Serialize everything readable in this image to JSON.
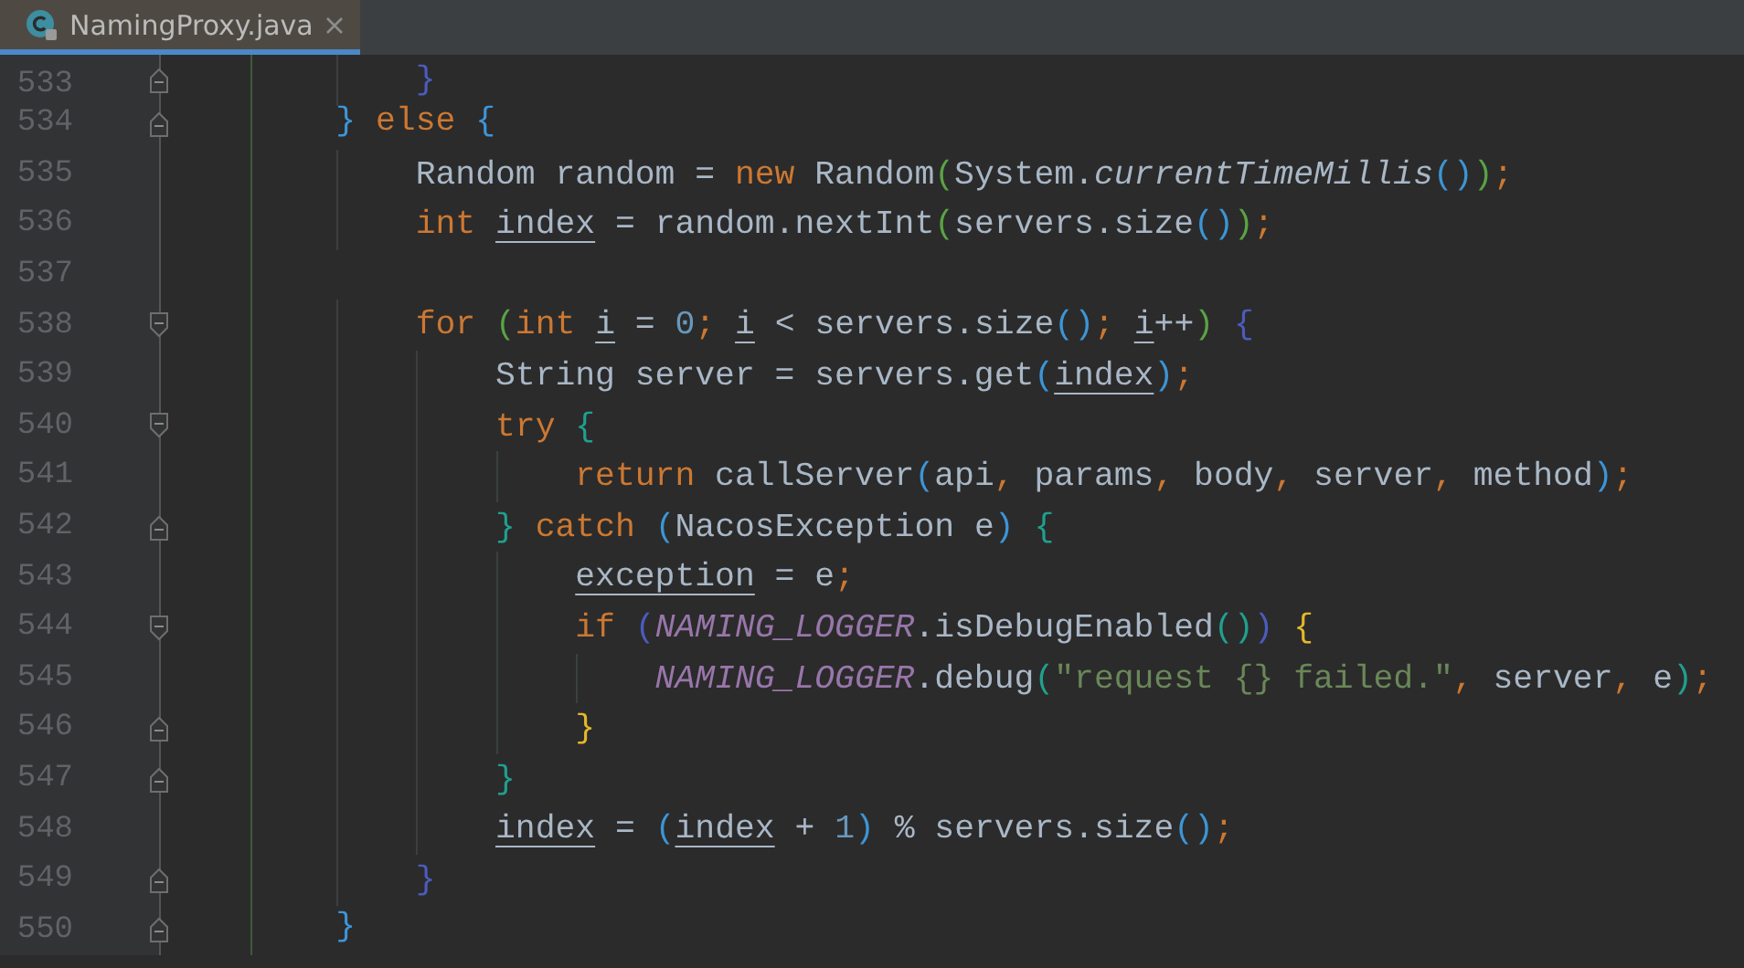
{
  "tab": {
    "title": "NamingProxy.java",
    "selected": true
  },
  "lines": [
    {
      "number": "533",
      "fold_start": false,
      "fold_end": true,
      "tokens": [
        {
          "text": "        }",
          "kind": "bracket",
          "color": "#4c5bbf"
        }
      ]
    },
    {
      "number": "534",
      "fold_start": false,
      "fold_end": true,
      "tokens": [
        {
          "text": "    }",
          "kind": "bracket",
          "color": "#3d95d6"
        },
        {
          "text": " else",
          "kind": "keyword"
        },
        {
          "text": " {",
          "kind": "bracket",
          "color": "#3d95d6"
        }
      ]
    },
    {
      "number": "535",
      "fold_start": false,
      "fold_end": false,
      "tokens": [
        {
          "text": "        Random random = ",
          "kind": "plain"
        },
        {
          "text": "new",
          "kind": "keyword"
        },
        {
          "text": " Random",
          "kind": "plain"
        },
        {
          "text": "(",
          "kind": "bracket",
          "color": "#5aa344"
        },
        {
          "text": "System.",
          "kind": "plain"
        },
        {
          "text": "currentTimeMillis",
          "kind": "italic"
        },
        {
          "text": "()",
          "kind": "bracket",
          "color": "#3d95d6"
        },
        {
          "text": ")",
          "kind": "bracket",
          "color": "#5aa344"
        },
        {
          "text": ";",
          "kind": "punct"
        }
      ]
    },
    {
      "number": "536",
      "fold_start": false,
      "fold_end": false,
      "tokens": [
        {
          "text": "        int ",
          "kind": "keyword"
        },
        {
          "text": "index",
          "kind": "reassigned"
        },
        {
          "text": " = random.nextInt",
          "kind": "plain"
        },
        {
          "text": "(",
          "kind": "bracket",
          "color": "#5aa344"
        },
        {
          "text": "servers.size",
          "kind": "plain"
        },
        {
          "text": "()",
          "kind": "bracket",
          "color": "#3d95d6"
        },
        {
          "text": ")",
          "kind": "bracket",
          "color": "#5aa344"
        },
        {
          "text": ";",
          "kind": "punct"
        }
      ]
    },
    {
      "number": "537",
      "fold_start": false,
      "fold_end": false
    },
    {
      "number": "538",
      "fold_start": true,
      "fold_end": false,
      "tokens": [
        {
          "text": "        for",
          "kind": "keyword"
        },
        {
          "text": " (",
          "kind": "bracket",
          "color": "#5aa344"
        },
        {
          "text": "int ",
          "kind": "keyword"
        },
        {
          "text": "i",
          "kind": "reassigned"
        },
        {
          "text": " = ",
          "kind": "plain"
        },
        {
          "text": "0",
          "kind": "number"
        },
        {
          "text": "; ",
          "kind": "punct"
        },
        {
          "text": "i",
          "kind": "reassigned"
        },
        {
          "text": " < servers.size",
          "kind": "plain"
        },
        {
          "text": "()",
          "kind": "bracket",
          "color": "#3d95d6"
        },
        {
          "text": "; ",
          "kind": "punct"
        },
        {
          "text": "i",
          "kind": "reassigned"
        },
        {
          "text": "++",
          "kind": "plain"
        },
        {
          "text": ")",
          "kind": "bracket",
          "color": "#5aa344"
        },
        {
          "text": " {",
          "kind": "bracket",
          "color": "#4c5bbf"
        }
      ]
    },
    {
      "number": "539",
      "fold_start": false,
      "fold_end": false,
      "tokens": [
        {
          "text": "            String server = servers.get",
          "kind": "plain"
        },
        {
          "text": "(",
          "kind": "bracket",
          "color": "#3d95d6"
        },
        {
          "text": "index",
          "kind": "reassigned"
        },
        {
          "text": ")",
          "kind": "bracket",
          "color": "#3d95d6"
        },
        {
          "text": ";",
          "kind": "punct"
        }
      ]
    },
    {
      "number": "540",
      "fold_start": true,
      "fold_end": false,
      "tokens": [
        {
          "text": "            try",
          "kind": "keyword"
        },
        {
          "text": " {",
          "kind": "bracket",
          "color": "#20a08f"
        }
      ]
    },
    {
      "number": "541",
      "fold_start": false,
      "fold_end": false,
      "tokens": [
        {
          "text": "                return",
          "kind": "keyword"
        },
        {
          "text": " callServer",
          "kind": "plain"
        },
        {
          "text": "(",
          "kind": "bracket",
          "color": "#3d95d6"
        },
        {
          "text": "api",
          "kind": "plain"
        },
        {
          "text": ",",
          "kind": "punct"
        },
        {
          "text": " params",
          "kind": "plain"
        },
        {
          "text": ",",
          "kind": "punct"
        },
        {
          "text": " body",
          "kind": "plain"
        },
        {
          "text": ",",
          "kind": "punct"
        },
        {
          "text": " server",
          "kind": "plain"
        },
        {
          "text": ",",
          "kind": "punct"
        },
        {
          "text": " method",
          "kind": "plain"
        },
        {
          "text": ")",
          "kind": "bracket",
          "color": "#3d95d6"
        },
        {
          "text": ";",
          "kind": "punct"
        }
      ]
    },
    {
      "number": "542",
      "fold_start": false,
      "fold_end": true,
      "tokens": [
        {
          "text": "            }",
          "kind": "bracket",
          "color": "#20a08f"
        },
        {
          "text": " catch",
          "kind": "keyword"
        },
        {
          "text": " (",
          "kind": "bracket",
          "color": "#3d95d6"
        },
        {
          "text": "NacosException e",
          "kind": "plain"
        },
        {
          "text": ")",
          "kind": "bracket",
          "color": "#3d95d6"
        },
        {
          "text": " {",
          "kind": "bracket",
          "color": "#20a08f"
        }
      ]
    },
    {
      "number": "543",
      "fold_start": false,
      "fold_end": false,
      "tokens": [
        {
          "text": "                exception",
          "kind": "reassigned"
        },
        {
          "text": " = e",
          "kind": "plain"
        },
        {
          "text": ";",
          "kind": "punct"
        }
      ]
    },
    {
      "number": "544",
      "fold_start": true,
      "fold_end": false,
      "tokens": [
        {
          "text": "                if",
          "kind": "keyword"
        },
        {
          "text": " (",
          "kind": "bracket",
          "color": "#4c5bbf"
        },
        {
          "text": "NAMING_LOGGER",
          "kind": "constant"
        },
        {
          "text": ".isDebugEnabled",
          "kind": "plain"
        },
        {
          "text": "()",
          "kind": "bracket",
          "color": "#20a08f"
        },
        {
          "text": ")",
          "kind": "bracket",
          "color": "#4c5bbf"
        },
        {
          "text": " {",
          "kind": "bracket",
          "color": "#e3b82a"
        }
      ]
    },
    {
      "number": "545",
      "fold_start": false,
      "fold_end": false,
      "tokens": [
        {
          "text": "                    NAMING_LOGGER",
          "kind": "constant"
        },
        {
          "text": ".debug",
          "kind": "plain"
        },
        {
          "text": "(",
          "kind": "bracket",
          "color": "#20a08f"
        },
        {
          "text": "\"request {} failed.\"",
          "kind": "string"
        },
        {
          "text": ",",
          "kind": "punct"
        },
        {
          "text": " server",
          "kind": "plain"
        },
        {
          "text": ",",
          "kind": "punct"
        },
        {
          "text": " e",
          "kind": "plain"
        },
        {
          "text": ")",
          "kind": "bracket",
          "color": "#20a08f"
        },
        {
          "text": ";",
          "kind": "punct"
        }
      ]
    },
    {
      "number": "546",
      "fold_start": false,
      "fold_end": true,
      "tokens": [
        {
          "text": "                }",
          "kind": "bracket",
          "color": "#e3b82a"
        }
      ]
    },
    {
      "number": "547",
      "fold_start": false,
      "fold_end": true,
      "tokens": [
        {
          "text": "            }",
          "kind": "bracket",
          "color": "#20a08f"
        }
      ]
    },
    {
      "number": "548",
      "fold_start": false,
      "fold_end": false,
      "tokens": [
        {
          "text": "            index",
          "kind": "reassigned"
        },
        {
          "text": " = ",
          "kind": "plain"
        },
        {
          "text": "(",
          "kind": "bracket",
          "color": "#3d95d6"
        },
        {
          "text": "index",
          "kind": "reassigned"
        },
        {
          "text": " + ",
          "kind": "plain"
        },
        {
          "text": "1",
          "kind": "number"
        },
        {
          "text": ")",
          "kind": "bracket",
          "color": "#3d95d6"
        },
        {
          "text": " % servers.size",
          "kind": "plain"
        },
        {
          "text": "()",
          "kind": "bracket",
          "color": "#3d95d6"
        },
        {
          "text": ";",
          "kind": "punct"
        }
      ]
    },
    {
      "number": "549",
      "fold_start": false,
      "fold_end": true,
      "tokens": [
        {
          "text": "        }",
          "kind": "bracket",
          "color": "#4c5bbf"
        }
      ]
    },
    {
      "number": "550",
      "fold_start": false,
      "fold_end": true,
      "tokens": [
        {
          "text": "    }",
          "kind": "bracket",
          "color": "#3d95d6"
        }
      ]
    }
  ]
}
